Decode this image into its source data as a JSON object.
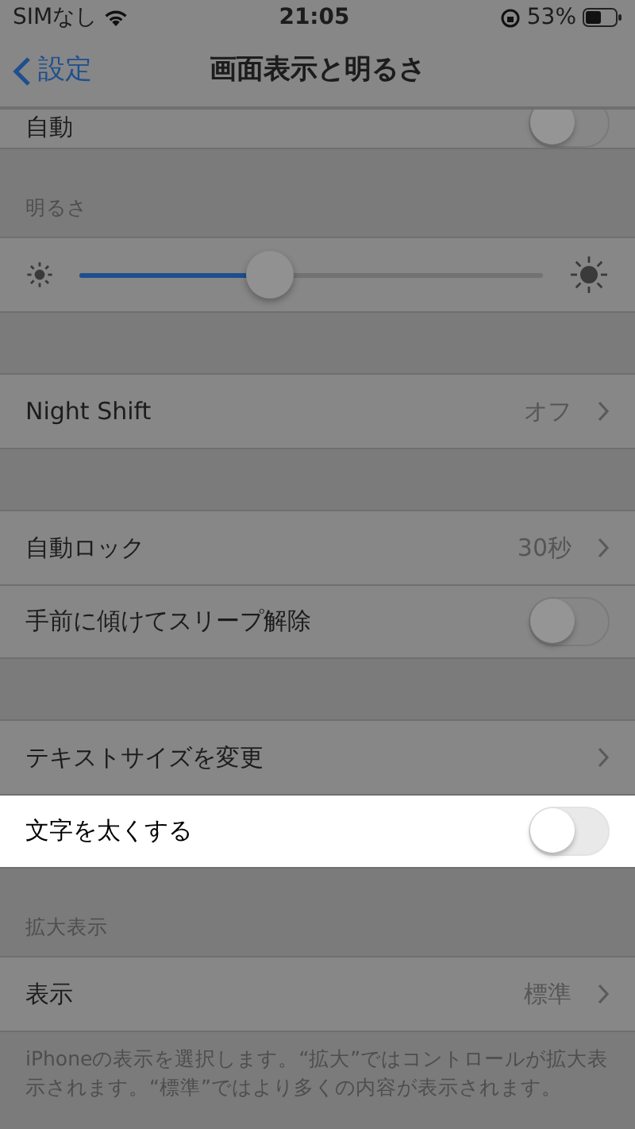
{
  "status_bar": {
    "carrier": "SIMなし",
    "time": "21:05",
    "battery": "53%"
  },
  "nav": {
    "back": "設定",
    "title": "画面表示と明るさ"
  },
  "sections": [
    {
      "clipped": true,
      "rows": [
        {
          "kind": "toggle",
          "label": "自動",
          "on": false,
          "highlighted": false
        }
      ]
    },
    {
      "header": "明るさ",
      "rows": [
        {
          "kind": "slider",
          "level": 0.41,
          "highlighted": false
        }
      ]
    },
    {
      "rows": [
        {
          "kind": "link",
          "label": "Night Shift",
          "value": "オフ",
          "highlighted": false
        }
      ]
    },
    {
      "rows": [
        {
          "kind": "link",
          "label": "自動ロック",
          "value": "30秒",
          "highlighted": false
        },
        {
          "kind": "toggle",
          "label": "手前に傾けてスリープ解除",
          "on": false,
          "highlighted": false
        }
      ]
    },
    {
      "rows": [
        {
          "kind": "link",
          "label": "テキストサイズを変更",
          "highlighted": false
        },
        {
          "kind": "toggle",
          "label": "文字を太くする",
          "on": false,
          "highlighted": true
        }
      ]
    },
    {
      "header": "拡大表示",
      "rows": [
        {
          "kind": "link",
          "label": "表示",
          "value": "標準",
          "highlighted": false
        }
      ],
      "footer": "iPhoneの表示を選択します。“拡大”ではコントロールが拡大表示されます。“標準”ではより多くの内容が表示されます。"
    }
  ]
}
